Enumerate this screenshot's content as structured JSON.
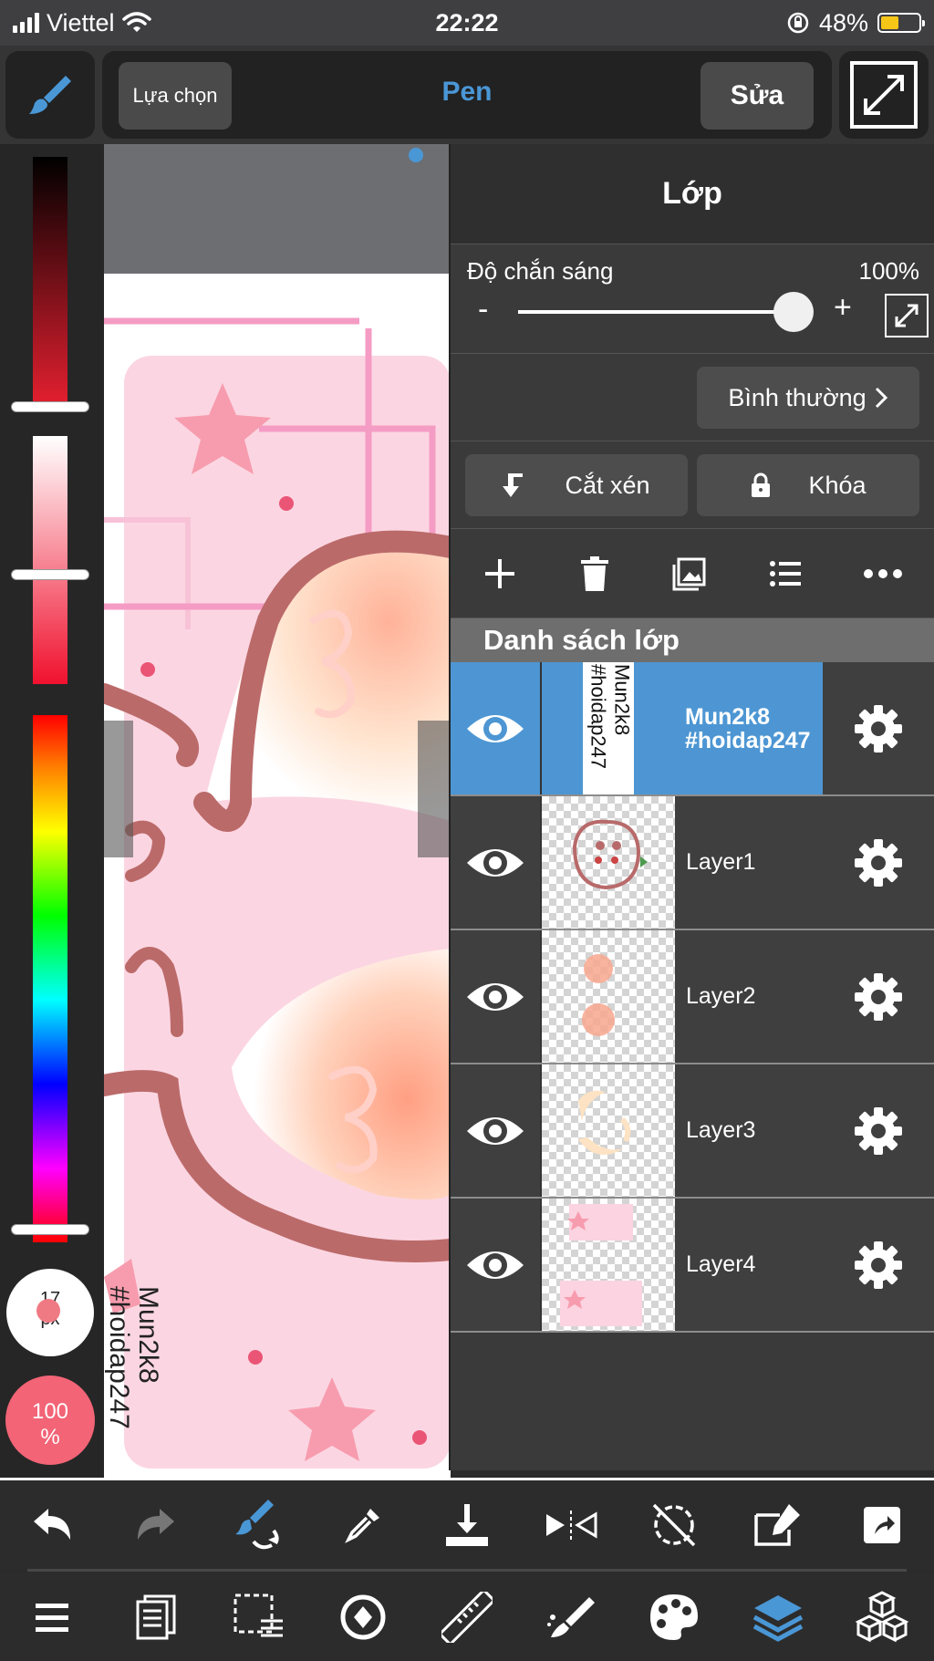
{
  "status_bar": {
    "carrier": "Viettel",
    "time": "22:22",
    "battery": "48%"
  },
  "toolbar": {
    "select_label": "Lựa chọn",
    "tool_name": "Pen",
    "edit_label": "Sửa"
  },
  "color_panel": {
    "brush_size": "17",
    "brush_size_unit": "px",
    "opacity_value": "100",
    "opacity_unit": "%"
  },
  "canvas": {
    "watermark_line1": "Mun2k8",
    "watermark_line2": "#hoidap247"
  },
  "layer_panel": {
    "title": "Lớp",
    "opacity_label": "Độ chắn sáng",
    "opacity_value": "100%",
    "minus": "-",
    "plus": "+",
    "blend_mode": "Bình thường",
    "clip_label": "Cắt xén",
    "lock_label": "Khóa",
    "list_title": "Danh sách lớp",
    "layers": [
      {
        "name_line1": "Mun2k8",
        "name_line2": "#hoidap247",
        "selected": true,
        "visible": true
      },
      {
        "name": "Layer1",
        "visible": true
      },
      {
        "name": "Layer2",
        "visible": true
      },
      {
        "name": "Layer3",
        "visible": true
      },
      {
        "name": "Layer4",
        "visible": true
      }
    ]
  },
  "colors": {
    "accent": "#4a97d6",
    "selected_row": "#4d96d3",
    "opacity_circle": "#f26476"
  },
  "icons": [
    "brush-icon",
    "expand-icon",
    "eye-icon",
    "gear-icon",
    "undo-icon",
    "redo-icon",
    "transform-icon",
    "eyedropper-icon",
    "save-icon",
    "flip-icon",
    "rotate-off-icon",
    "edit-icon",
    "share-icon",
    "menu-icon",
    "pages-icon",
    "selection-icon",
    "lasso-icon",
    "ruler-icon",
    "fill-icon",
    "palette-icon",
    "layers-icon",
    "materials-icon"
  ]
}
